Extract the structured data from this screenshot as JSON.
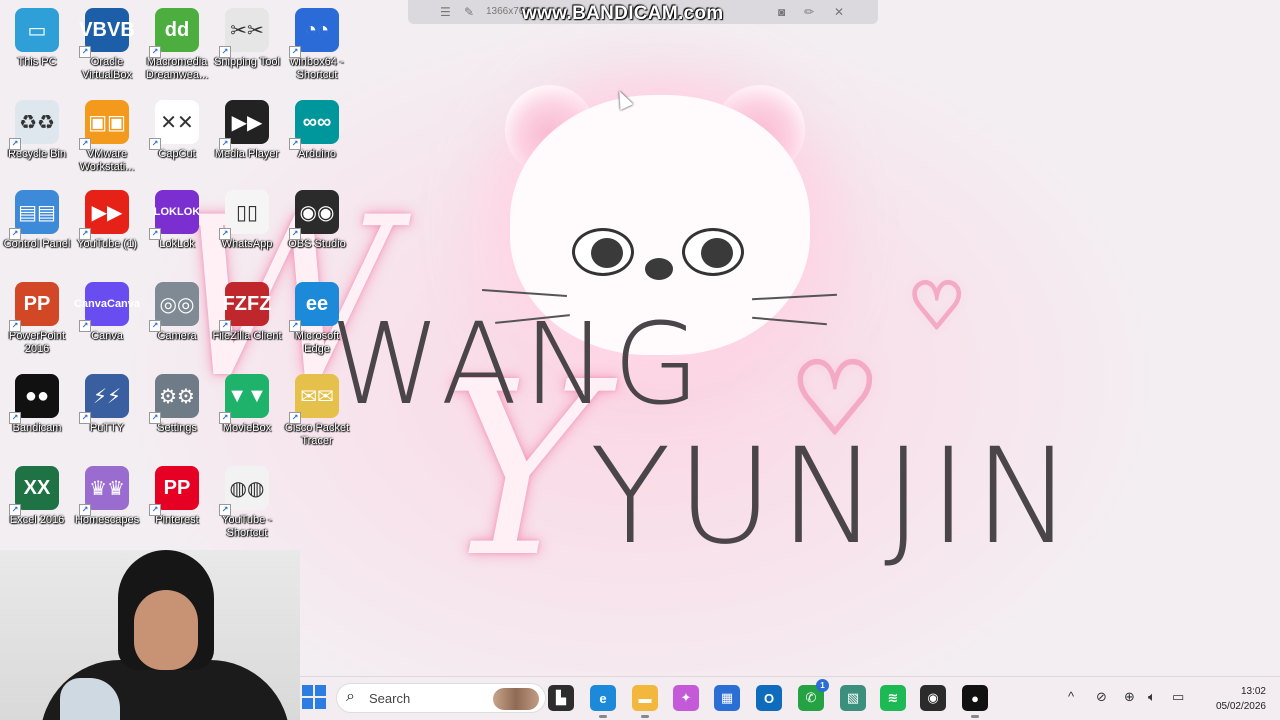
{
  "watermark": {
    "text": "www.BANDICAM.com",
    "resolution": "1366x768"
  },
  "wallpaper": {
    "line1": "WANG",
    "line2": "YUNJIN",
    "script1": "W",
    "script2": "Y",
    "heart": "♡"
  },
  "desktop_icons": [
    {
      "label": "This PC",
      "icon": "monitor-icon",
      "color": "#2f9fd8",
      "glyph": "▭"
    },
    {
      "label": "Oracle VirtualBox",
      "icon": "virtualbox-icon",
      "color": "#1c5fa8",
      "glyph": "VB"
    },
    {
      "label": "Macromedia Dreamwea...",
      "icon": "dreamweaver-icon",
      "color": "#4cae3f",
      "glyph": "d"
    },
    {
      "label": "Snipping Tool",
      "icon": "scissors-icon",
      "color": "#e6e6e6",
      "glyph": "✂"
    },
    {
      "label": "winbox64 - Shortcut",
      "icon": "winbox-icon",
      "color": "#2a6bd8",
      "glyph": "◔"
    },
    {
      "label": "Recycle Bin",
      "icon": "recycle-bin-icon",
      "color": "#dfe7ee",
      "glyph": "♻"
    },
    {
      "label": "VMware Workstati...",
      "icon": "vmware-icon",
      "color": "#f39a1d",
      "glyph": "▣"
    },
    {
      "label": "CapCut",
      "icon": "capcut-icon",
      "color": "#ffffff",
      "glyph": "✕"
    },
    {
      "label": "Media Player",
      "icon": "media-player-icon",
      "color": "#222222",
      "glyph": "▶"
    },
    {
      "label": "Arduino",
      "icon": "arduino-icon",
      "color": "#00979c",
      "glyph": "∞"
    },
    {
      "label": "Control Panel",
      "icon": "control-panel-icon",
      "color": "#3d8ad8",
      "glyph": "▤"
    },
    {
      "label": "YouTube (1)",
      "icon": "youtube-icon",
      "color": "#e62117",
      "glyph": "▶"
    },
    {
      "label": "LokLok",
      "icon": "loklok-icon",
      "color": "#7b2fd0",
      "glyph": "LOK"
    },
    {
      "label": "WhatsApp",
      "icon": "file-icon",
      "color": "#f5f5f5",
      "glyph": "▯"
    },
    {
      "label": "OBS Studio",
      "icon": "obs-icon",
      "color": "#2b2b2b",
      "glyph": "◉"
    },
    {
      "label": "PowerPoint 2016",
      "icon": "powerpoint-icon",
      "color": "#d24726",
      "glyph": "P"
    },
    {
      "label": "Canva",
      "icon": "canva-icon",
      "color": "#6a4df0",
      "glyph": "Canva"
    },
    {
      "label": "Camera",
      "icon": "camera-icon",
      "color": "#7f8a94",
      "glyph": "◎"
    },
    {
      "label": "FileZilla Client",
      "icon": "filezilla-icon",
      "color": "#c0272d",
      "glyph": "FZ"
    },
    {
      "label": "Microsoft Edge",
      "icon": "edge-icon",
      "color": "#1c8ad8",
      "glyph": "e"
    },
    {
      "label": "Bandicam",
      "icon": "bandicam-icon",
      "color": "#111111",
      "glyph": "●"
    },
    {
      "label": "PuTTY",
      "icon": "putty-icon",
      "color": "#3a5fa0",
      "glyph": "⚡"
    },
    {
      "label": "Settings",
      "icon": "gear-icon",
      "color": "#6f7c88",
      "glyph": "⚙"
    },
    {
      "label": "MovieBox",
      "icon": "moviebox-icon",
      "color": "#1fb26a",
      "glyph": "▼"
    },
    {
      "label": "Cisco Packet Tracer",
      "icon": "packet-tracer-icon",
      "color": "#e5c04a",
      "glyph": "✉"
    },
    {
      "label": "Excel 2016",
      "icon": "excel-icon",
      "color": "#1f7244",
      "glyph": "X"
    },
    {
      "label": "Homescapes",
      "icon": "homescapes-icon",
      "color": "#9a6ccf",
      "glyph": "♛"
    },
    {
      "label": "Pinterest",
      "icon": "pinterest-icon",
      "color": "#e60023",
      "glyph": "P"
    },
    {
      "label": "YouTube - Shortcut",
      "icon": "chrome-icon",
      "color": "#f2f2f2",
      "glyph": "◍"
    }
  ],
  "taskbar": {
    "search_placeholder": "Search",
    "apps": [
      {
        "name": "file-explorer-stack-icon",
        "color": "#2d2d2d",
        "glyph": "▙"
      },
      {
        "name": "edge-taskbar-icon",
        "color": "#1c8ad8",
        "glyph": "e"
      },
      {
        "name": "file-explorer-icon",
        "color": "#f2b73c",
        "glyph": "▬"
      },
      {
        "name": "copilot-icon",
        "color": "#c45ad8",
        "glyph": "✦"
      },
      {
        "name": "store-icon",
        "color": "#2b6fd4",
        "glyph": "▦"
      },
      {
        "name": "outlook-icon",
        "color": "#0f6cbd",
        "glyph": "O"
      },
      {
        "name": "whatsapp-icon",
        "color": "#25a244",
        "glyph": "✆",
        "badge": "1"
      },
      {
        "name": "winbox-taskbar-icon",
        "color": "#3a8f7d",
        "glyph": "▧"
      },
      {
        "name": "spotify-icon",
        "color": "#1db954",
        "glyph": "≋"
      },
      {
        "name": "obs-taskbar-icon",
        "color": "#2b2b2b",
        "glyph": "◉"
      },
      {
        "name": "bandicam-taskbar-icon",
        "color": "#111111",
        "glyph": "●"
      }
    ],
    "tray": {
      "chevron": "^",
      "time": "13:02",
      "date": "05/02/2026"
    }
  }
}
